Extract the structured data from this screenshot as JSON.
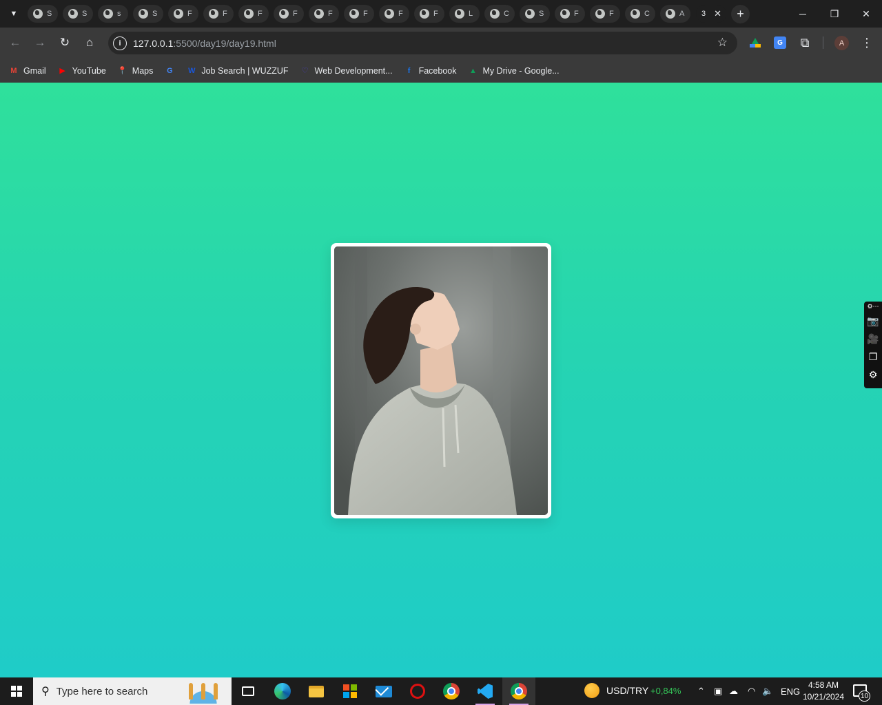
{
  "browser": {
    "tab_letters": [
      "S",
      "S",
      "s",
      "S",
      "F",
      "F",
      "F",
      "F",
      "F",
      "F",
      "F",
      "F",
      "L",
      "C",
      "S",
      "F",
      "F",
      "C",
      "A"
    ],
    "active_tab_label": "3",
    "new_tab": "+",
    "window_controls": {
      "minimize": "─",
      "restore": "❐",
      "close": "✕"
    },
    "url_host": "127.0.0.1",
    "url_rest": ":5500/day19/day19.html",
    "profile_initial": "A"
  },
  "bookmarks": [
    {
      "label": "Gmail",
      "icon": "gmail-icon",
      "icon_text": "M",
      "color": "#ea4335"
    },
    {
      "label": "YouTube",
      "icon": "youtube-icon",
      "icon_text": "▶",
      "color": "#ff0000"
    },
    {
      "label": "Maps",
      "icon": "maps-icon",
      "icon_text": "📍",
      "color": "#34a853"
    },
    {
      "label": "",
      "icon": "google-icon",
      "icon_text": "G",
      "color": "#4285f4"
    },
    {
      "label": "Job Search | WUZZUF",
      "icon": "wuzzuf-icon",
      "icon_text": "W",
      "color": "#1b57d9"
    },
    {
      "label": "Web Development...",
      "icon": "webdev-icon",
      "icon_text": "♡",
      "color": "#4b3fd1"
    },
    {
      "label": "Facebook",
      "icon": "facebook-icon",
      "icon_text": "f",
      "color": "#1877f2"
    },
    {
      "label": "My Drive - Google...",
      "icon": "drive-icon",
      "icon_text": "▲",
      "color": "#0f9d58"
    }
  ],
  "page": {
    "background_top": "#2fe09b",
    "background_bottom": "#1fccc8",
    "card_background": "#ffffff"
  },
  "taskbar": {
    "search_placeholder": "Type here to search",
    "currency_pair": "USD/TRY",
    "currency_change": "+0,84%",
    "language": "ENG",
    "time": "4:58 AM",
    "date": "10/21/2024",
    "notification_count": "10"
  }
}
